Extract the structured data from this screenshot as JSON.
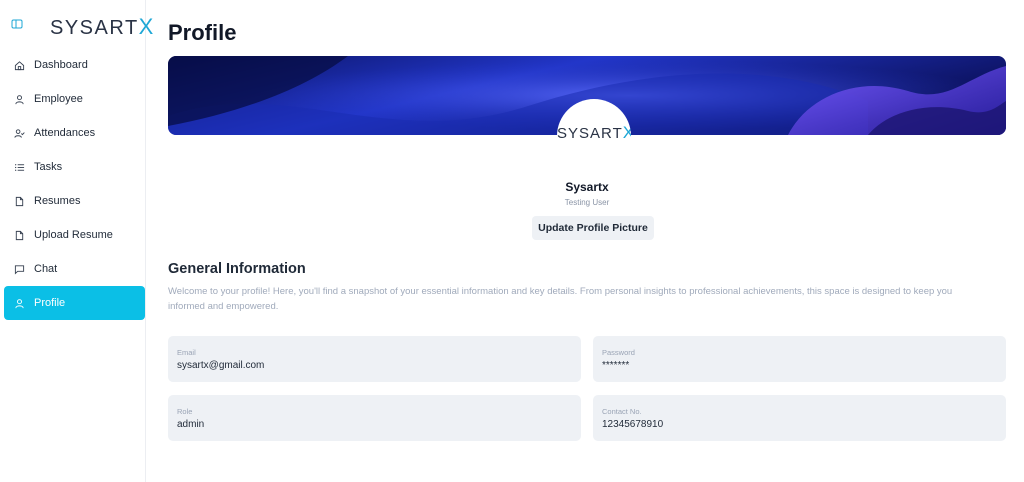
{
  "brand": {
    "name_main": "SYSART",
    "name_x": "X"
  },
  "sidebar": {
    "items": [
      {
        "label": "Dashboard",
        "icon": "home-icon",
        "active": false
      },
      {
        "label": "Employee",
        "icon": "user-icon",
        "active": false
      },
      {
        "label": "Attendances",
        "icon": "user-check-icon",
        "active": false
      },
      {
        "label": "Tasks",
        "icon": "list-icon",
        "active": false
      },
      {
        "label": "Resumes",
        "icon": "file-icon",
        "active": false
      },
      {
        "label": "Upload Resume",
        "icon": "file-icon",
        "active": false
      },
      {
        "label": "Chat",
        "icon": "message-icon",
        "active": false
      },
      {
        "label": "Profile",
        "icon": "user-icon",
        "active": true
      }
    ]
  },
  "page": {
    "title": "Profile"
  },
  "profile": {
    "name": "Sysartx",
    "role": "Testing User",
    "update_picture_label": "Update Profile Picture"
  },
  "general": {
    "title": "General Information",
    "description": "Welcome to your profile! Here, you'll find a snapshot of your essential information and key details. From personal insights to professional achievements, this space is designed to keep you informed and empowered.",
    "fields": {
      "email": {
        "label": "Email",
        "value": "sysartx@gmail.com"
      },
      "password": {
        "label": "Password",
        "value": "*******"
      },
      "role": {
        "label": "Role",
        "value": "admin"
      },
      "contact": {
        "label": "Contact No.",
        "value": "12345678910"
      }
    }
  },
  "colors": {
    "accent": "#0bbfe6",
    "logo_x": "#1ea7d6",
    "field_bg": "#eef1f5"
  }
}
